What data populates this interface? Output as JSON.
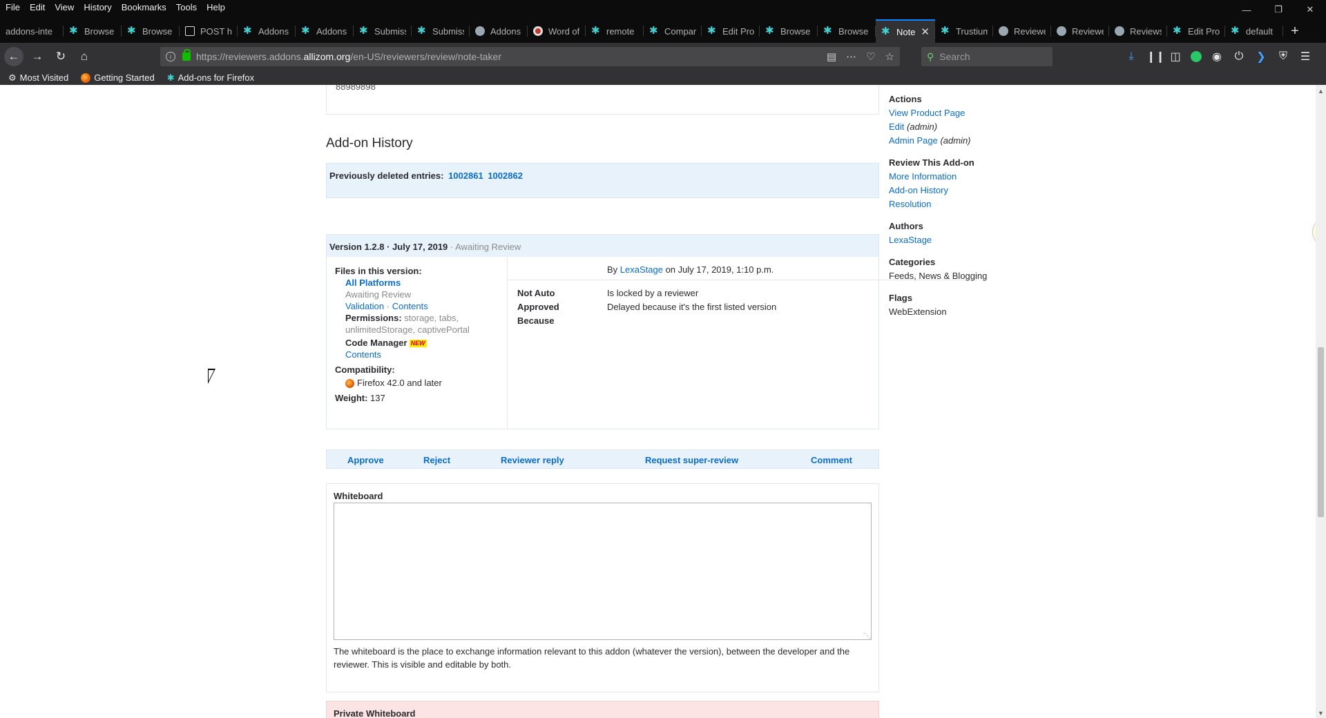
{
  "menubar": [
    "File",
    "Edit",
    "View",
    "History",
    "Bookmarks",
    "Tools",
    "Help"
  ],
  "tabs": [
    {
      "label": "addons-inte",
      "icon": "none"
    },
    {
      "label": "Browse",
      "icon": "wrench"
    },
    {
      "label": "Browse",
      "icon": "wrench"
    },
    {
      "label": "POST ht",
      "icon": "post"
    },
    {
      "label": "Addons",
      "icon": "wrench"
    },
    {
      "label": "Addons",
      "icon": "wrench"
    },
    {
      "label": "Submiss",
      "icon": "wrench"
    },
    {
      "label": "Submiss",
      "icon": "wrench"
    },
    {
      "label": "Addons",
      "icon": "avatar"
    },
    {
      "label": "Word of",
      "icon": "word"
    },
    {
      "label": "remote",
      "icon": "wrench"
    },
    {
      "label": "Compar",
      "icon": "wrench"
    },
    {
      "label": "Edit Pro",
      "icon": "wrench"
    },
    {
      "label": "Browse",
      "icon": "wrench"
    },
    {
      "label": "Browse",
      "icon": "wrench"
    },
    {
      "label": "Note",
      "icon": "wrench",
      "active": true
    },
    {
      "label": "Trustium",
      "icon": "wrench"
    },
    {
      "label": "Reviewe",
      "icon": "avatar"
    },
    {
      "label": "Reviewe",
      "icon": "avatar"
    },
    {
      "label": "Reviews",
      "icon": "avatar"
    },
    {
      "label": "Edit Pro",
      "icon": "wrench"
    },
    {
      "label": "default",
      "icon": "wrench"
    }
  ],
  "urlbar": {
    "prefix": "https://reviewers.addons.",
    "host": "allizom.org",
    "path": "/en-US/reviewers/review/note-taker"
  },
  "search": {
    "placeholder": "Search"
  },
  "bookmarks": [
    {
      "label": "Most Visited",
      "icon": "gear-icon"
    },
    {
      "label": "Getting Started",
      "icon": "firefox-icon"
    },
    {
      "label": "Add-ons for Firefox",
      "icon": "wrench-icon"
    }
  ],
  "page": {
    "top_number": "88989898",
    "history_title": "Add-on History",
    "deleted_label": "Previously deleted entries:",
    "deleted_ids": [
      "1002861",
      "1002862"
    ],
    "version": {
      "heading": "Version 1.2.8 · July 17, 2019",
      "status": " · Awaiting Review",
      "files_label": "Files in this version:",
      "platform": "All Platforms",
      "platform_status": "Awaiting Review",
      "validation": "Validation",
      "separator": " · ",
      "contents": "Contents",
      "permissions_label": "Permissions:",
      "permissions": " storage, tabs, unlimitedStorage, captivePortal",
      "code_manager": "Code Manager",
      "new_badge": "NEW",
      "code_manager_contents": "Contents",
      "compat_label": "Compatibility:",
      "compat_value": "Firefox 42.0 and later",
      "weight_label": "Weight:",
      "weight_value": " 137",
      "by": "By ",
      "author": "LexaStage",
      "by_date": " on July 17, 2019, 1:10 p.m.",
      "reason_label": "Not Auto Approved Because",
      "reasons": [
        "Is locked by a reviewer",
        "Delayed because it's the first listed version"
      ]
    },
    "actions": [
      "Approve",
      "Reject",
      "Reviewer reply",
      "Request super-review",
      "Comment"
    ],
    "whiteboard": {
      "title": "Whiteboard",
      "value": "",
      "help": "The whiteboard is the place to exchange information relevant to this addon (whatever the version), between the developer and the reviewer. This is visible and editable by both."
    },
    "private_whiteboard_title": "Private Whiteboard"
  },
  "sidebar": {
    "actions_title": "Actions",
    "view_product": "View Product Page",
    "edit": "Edit",
    "admin": " (admin)",
    "admin_page": "Admin Page",
    "review_title": "Review This Add-on",
    "more_info": "More Information",
    "addon_history": "Add-on History",
    "resolution": "Resolution",
    "authors_title": "Authors",
    "author": "LexaStage",
    "categories_title": "Categories",
    "categories": "Feeds, News & Blogging",
    "flags_title": "Flags",
    "flags": "WebExtension"
  }
}
